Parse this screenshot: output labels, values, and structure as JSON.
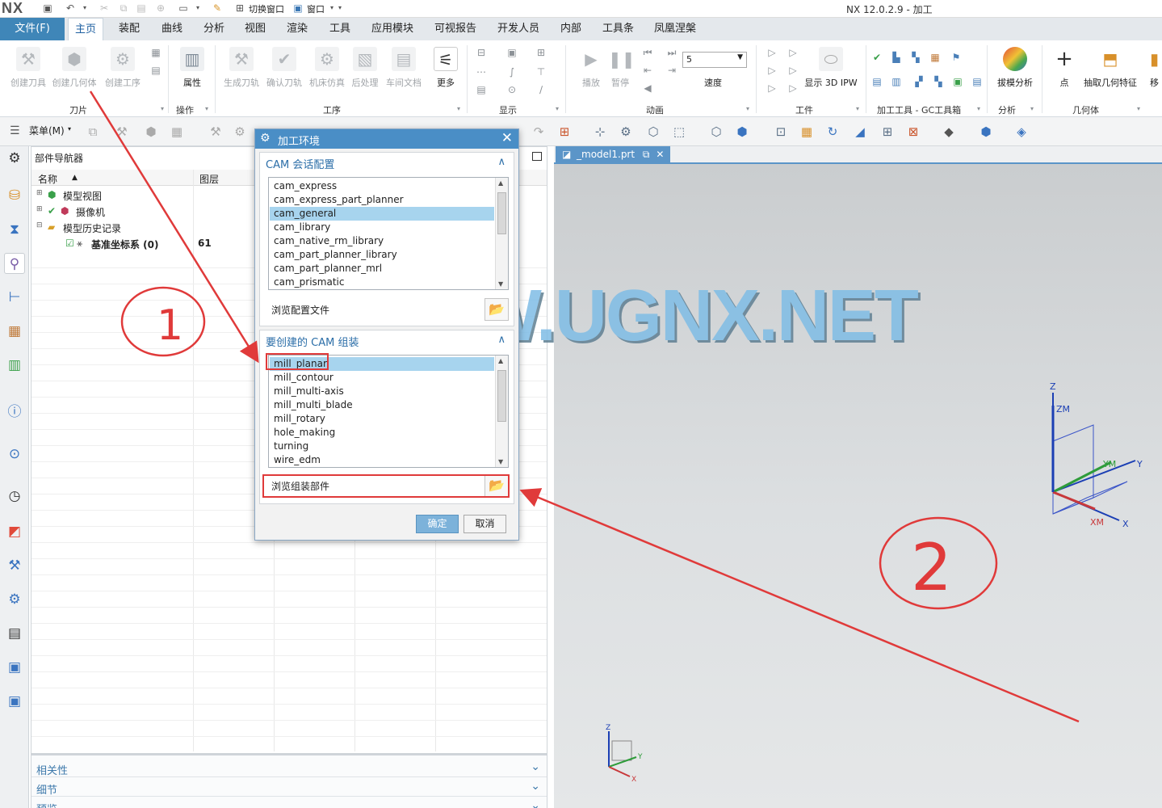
{
  "app": {
    "logo": "NX",
    "window_title": "NX 12.0.2.9 - 加工",
    "quick_access": {
      "switch_window": "切换窗口",
      "window": "窗口"
    }
  },
  "menu": {
    "file": "文件(F)",
    "tabs": [
      "主页",
      "装配",
      "曲线",
      "分析",
      "视图",
      "渲染",
      "工具",
      "应用模块",
      "可视报告",
      "开发人员",
      "内部",
      "工具条",
      "凤凰涅槃"
    ],
    "active_tab": "主页"
  },
  "ribbon": {
    "knife": {
      "create_tool": "创建刀具",
      "create_geometry": "创建几何体",
      "create_operation": "创建工序",
      "group": "刀片"
    },
    "operation": {
      "properties": "属性",
      "group": "操作"
    },
    "procedure": {
      "gen_toolpath": "生成刀轨",
      "verify_toolpath": "确认刀轨",
      "machine_sim": "机床仿真",
      "postprocess": "后处理",
      "shop_doc": "车间文档",
      "more": "更多",
      "group": "工序"
    },
    "display": {
      "group": "显示"
    },
    "animation": {
      "play": "播放",
      "pause": "暂停",
      "speed_value": "5",
      "speed": "速度",
      "group": "动画"
    },
    "workpiece": {
      "show_3d_ipw": "显示 3D IPW",
      "group": "工件"
    },
    "gc_tools": {
      "group": "加工工具 - GC工具箱"
    },
    "analysis": {
      "draft_analysis": "拔模分析",
      "group": "分析"
    },
    "geometry": {
      "point": "点",
      "extract_geometry": "抽取几何特征",
      "group": "几何体",
      "cut_label": "移"
    }
  },
  "toolbar2": {
    "menu_label": "菜单(M)"
  },
  "navigator": {
    "title": "部件导航器",
    "col_name": "名称",
    "col_layer": "图层",
    "rows": [
      {
        "name": "模型视图",
        "layer": ""
      },
      {
        "name": "摄像机",
        "layer": ""
      },
      {
        "name": "模型历史记录",
        "layer": ""
      },
      {
        "name": "基准坐标系 (0)",
        "layer": "61"
      }
    ],
    "sections": [
      "相关性",
      "细节",
      "预览"
    ]
  },
  "graphics": {
    "tab_label": "_model1.prt",
    "triad_labels": {
      "z": "Z",
      "zm": "ZM",
      "ym": "YM",
      "y": "Y",
      "xm": "XM",
      "x": "X"
    },
    "mini_triad_labels": {
      "z": "Z",
      "y": "Y",
      "x": "X"
    }
  },
  "watermark": "WWW.UGNX.NET",
  "dialog": {
    "title": "加工环境",
    "session_config": {
      "heading": "CAM 会话配置",
      "items": [
        "cam_express",
        "cam_express_part_planner",
        "cam_general",
        "cam_library",
        "cam_native_rm_library",
        "cam_part_planner_library",
        "cam_part_planner_mrl",
        "cam_prismatic"
      ],
      "selected": "cam_general",
      "browse_label": "浏览配置文件"
    },
    "setup": {
      "heading": "要创建的 CAM 组装",
      "items": [
        "mill_planar",
        "mill_contour",
        "mill_multi-axis",
        "mill_multi_blade",
        "mill_rotary",
        "hole_making",
        "turning",
        "wire_edm"
      ],
      "selected": "mill_planar",
      "browse_label": "浏览组装部件"
    },
    "ok": "确定",
    "cancel": "取消"
  },
  "annotation": {
    "marker_1": "1",
    "marker_2": "2",
    "color": "#e03a3a"
  }
}
